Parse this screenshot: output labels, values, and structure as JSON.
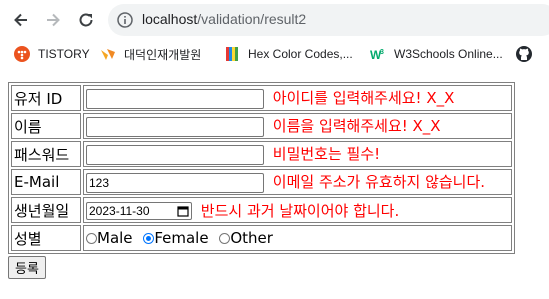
{
  "browser": {
    "url_host": "localhost",
    "url_path": "/validation/result2"
  },
  "bookmarks": [
    {
      "label": "TISTORY",
      "icon": "tistory-icon",
      "color": "#eb531f"
    },
    {
      "label": "대덕인재개발원",
      "icon": "ddit-icon",
      "color": "#f5a623"
    },
    {
      "label": "Hex Color Codes,...",
      "icon": "color-book-icon",
      "color": "#e53935"
    },
    {
      "label": "W3Schools Online...",
      "icon": "w3schools-icon",
      "color": "#04aa6d"
    },
    {
      "label": "",
      "icon": "github-icon",
      "color": "#24292f"
    }
  ],
  "form": {
    "rows": {
      "userid": {
        "label": "유저 ID",
        "value": "",
        "error": "아이디를 입력해주세요! X_X"
      },
      "name": {
        "label": "이름",
        "value": "",
        "error": "이름을 입력해주세요! X_X"
      },
      "password": {
        "label": "패스워드",
        "value": "",
        "error": "비밀번호는 필수!"
      },
      "email": {
        "label": "E-Mail",
        "value": "123",
        "error": "이메일 주소가 유효하지 않습니다."
      },
      "birth": {
        "label": "생년월일",
        "value": "2023-11-30",
        "error": "반드시 과거 날짜이어야 합니다."
      },
      "gender": {
        "label": "성별",
        "options": [
          "Male",
          "Female",
          "Other"
        ],
        "selected": "Female"
      }
    },
    "submit_label": "등록"
  },
  "colors": {
    "error": "#ff0000",
    "radio_accent": "#0075ff"
  }
}
